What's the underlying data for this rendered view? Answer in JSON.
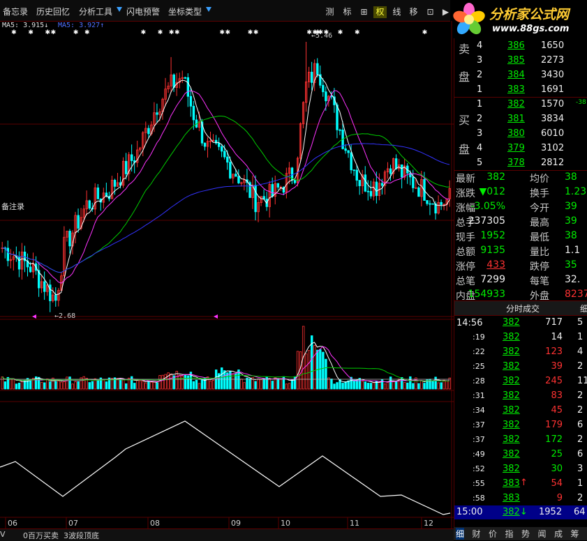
{
  "toolbar": {
    "memo": "备忘录",
    "history": "历史回忆",
    "analysis": "分析工具",
    "alert": "闪电预警",
    "coord": "坐标类型",
    "right_buttons": [
      {
        "label": "测"
      },
      {
        "label": "标"
      },
      {
        "label": "⊞"
      },
      {
        "label": "权"
      },
      {
        "label": "线"
      },
      {
        "label": "移"
      },
      {
        "label": "⊡"
      },
      {
        "label": "▶"
      }
    ]
  },
  "ma": {
    "ma5_label": "MA5: 3.915↓",
    "ma5b_label": "MA5: 3.927↑"
  },
  "logo": {
    "title": "分析家公式网",
    "url": "www.88gs.com"
  },
  "chart": {
    "high_label": "5.46",
    "low_label": "2.68",
    "left_label": "备注录",
    "xlabels": [
      "06",
      "07",
      "08",
      "09",
      "10",
      "11",
      "12"
    ],
    "colors": {
      "up": "#ff3232",
      "down": "#00ffff",
      "ma1": "#ffffff",
      "ma2": "#ff33ff",
      "ma3": "#00cc00",
      "ma4": "#3333ff"
    }
  },
  "orderbook": {
    "sell_label": [
      "卖",
      "盘"
    ],
    "buy_label": [
      "买",
      "盘"
    ],
    "sell": [
      {
        "level": "4",
        "price": "386",
        "vol": "1650"
      },
      {
        "level": "3",
        "price": "385",
        "vol": "2273"
      },
      {
        "level": "2",
        "price": "384",
        "vol": "3430"
      },
      {
        "level": "1",
        "price": "383",
        "vol": "1691"
      }
    ],
    "buy": [
      {
        "level": "1",
        "price": "382",
        "vol": "1570",
        "extra": "-38"
      },
      {
        "level": "2",
        "price": "381",
        "vol": "3834",
        "extra": ""
      },
      {
        "level": "3",
        "price": "380",
        "vol": "6010",
        "extra": ""
      },
      {
        "level": "4",
        "price": "379",
        "vol": "3102",
        "extra": ""
      },
      {
        "level": "5",
        "price": "378",
        "vol": "2812",
        "extra": ""
      }
    ]
  },
  "quote": [
    {
      "k1": "最新",
      "v1": "382",
      "k2": "均价",
      "v2": "38"
    },
    {
      "k1": "涨跌",
      "v1": "▼012",
      "k2": "换手",
      "v2": "1.23"
    },
    {
      "k1": "涨幅",
      "v1": "-3.05%",
      "k2": "今开",
      "v2": "39"
    },
    {
      "k1": "总手",
      "v1": "237305",
      "k2": "最高",
      "v2": "39"
    },
    {
      "k1": "现手",
      "v1": "1952",
      "k2": "最低",
      "v2": "38"
    },
    {
      "k1": "总额",
      "v1": "9135",
      "k2": "量比",
      "v2": "1.1"
    },
    {
      "k1": "涨停",
      "v1": "433",
      "k2": "跌停",
      "v2": "35"
    },
    {
      "k1": "总笔",
      "v1": "7299",
      "k2": "每笔",
      "v2": "32."
    },
    {
      "k1": "内盘",
      "v1": "154933",
      "k2": "外盘",
      "v2": "8237"
    }
  ],
  "trades": {
    "header": "分时成交",
    "header_right": "细",
    "rows": [
      {
        "time": "14:56",
        "price": "382",
        "vol": "717",
        "n": "5",
        "arrow": ""
      },
      {
        "time": ":19",
        "price": "382",
        "vol": "14",
        "n": "1",
        "arrow": ""
      },
      {
        "time": ":22",
        "price": "382",
        "vol": "123",
        "n": "4",
        "arrow": ""
      },
      {
        "time": ":25",
        "price": "382",
        "vol": "39",
        "n": "2",
        "arrow": ""
      },
      {
        "time": ":28",
        "price": "382",
        "vol": "245",
        "n": "11",
        "arrow": ""
      },
      {
        "time": ":31",
        "price": "382",
        "vol": "83",
        "n": "2",
        "arrow": ""
      },
      {
        "time": ":34",
        "price": "382",
        "vol": "45",
        "n": "2",
        "arrow": ""
      },
      {
        "time": ":37",
        "price": "382",
        "vol": "179",
        "n": "6",
        "arrow": ""
      },
      {
        "time": ":37",
        "price": "382",
        "vol": "172",
        "n": "2",
        "arrow": ""
      },
      {
        "time": ":49",
        "price": "382",
        "vol": "25",
        "n": "6",
        "arrow": ""
      },
      {
        "time": ":52",
        "price": "382",
        "vol": "30",
        "n": "3",
        "arrow": ""
      },
      {
        "time": ":55",
        "price": "383",
        "vol": "54",
        "n": "1",
        "arrow": "↑"
      },
      {
        "time": ":58",
        "price": "383",
        "vol": "9",
        "n": "2",
        "arrow": ""
      }
    ],
    "last": {
      "time": "15:00",
      "price": "382",
      "arrow": "↓",
      "vol": "1952",
      "n": "64"
    }
  },
  "bottom_tabs": [
    "V",
    "0百万买卖",
    "3波段顶底"
  ],
  "right_tabs": [
    "细",
    "财",
    "价",
    "指",
    "势",
    "闻",
    "成",
    "筹"
  ]
}
